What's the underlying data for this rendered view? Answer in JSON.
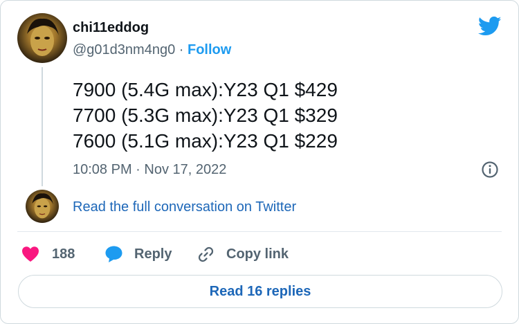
{
  "author": {
    "display_name": "chi11eddog",
    "handle": "@g01d3nm4ng0",
    "separator": "·",
    "follow_label": "Follow"
  },
  "tweet": {
    "lines": [
      "7900 (5.4G max):Y23 Q1 $429",
      "7700 (5.3G max):Y23 Q1 $329",
      "7600 (5.1G max):Y23 Q1 $229"
    ],
    "timestamp": "10:08 PM · Nov 17, 2022"
  },
  "conversation": {
    "link_label": "Read the full conversation on Twitter"
  },
  "actions": {
    "like_count": "188",
    "reply_label": "Reply",
    "copy_link_label": "Copy link"
  },
  "footer": {
    "read_replies_label": "Read 16 replies"
  },
  "icons": {
    "brand": "twitter-bird-icon",
    "info": "info-icon",
    "like": "heart-icon",
    "reply": "speech-bubble-icon",
    "copy": "link-icon"
  },
  "colors": {
    "brand_blue": "#1d9bf0",
    "link_blue": "#1d67b8",
    "like_pink": "#f91880",
    "muted_text": "#536471",
    "border": "#cfd9de"
  }
}
